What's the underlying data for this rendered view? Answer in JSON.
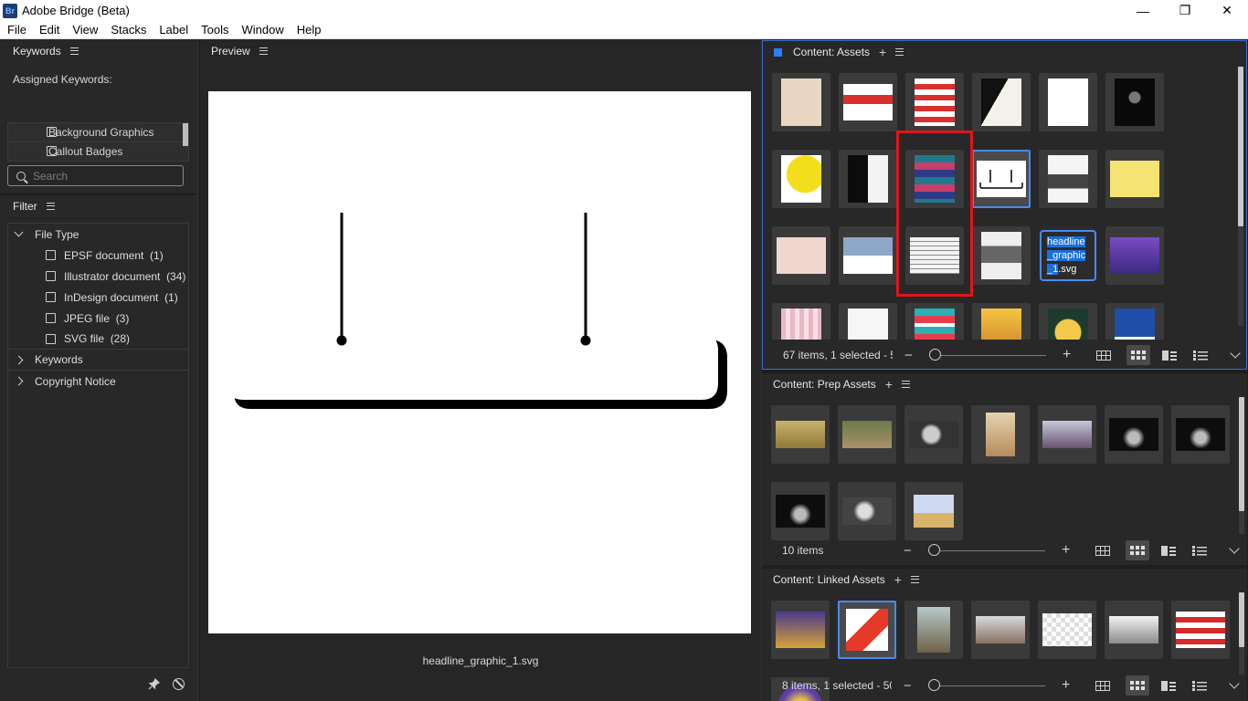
{
  "app": {
    "icon_text": "Br",
    "title": "Adobe Bridge (Beta)",
    "controls": {
      "minimize": "—",
      "restore": "❐",
      "close": "✕"
    }
  },
  "menu": [
    "File",
    "Edit",
    "View",
    "Stacks",
    "Label",
    "Tools",
    "Window",
    "Help"
  ],
  "keywords_panel": {
    "title": "Keywords",
    "assigned_label": "Assigned Keywords:",
    "items": [
      "Background Graphics",
      "Callout Badges"
    ],
    "search_placeholder": "Search"
  },
  "filter_panel": {
    "title": "Filter",
    "file_type_label": "File Type",
    "file_types": [
      {
        "label": "EPSF document",
        "count": "(1)"
      },
      {
        "label": "Illustrator document",
        "count": "(34)"
      },
      {
        "label": "InDesign document",
        "count": "(1)"
      },
      {
        "label": "JPEG file",
        "count": "(3)"
      },
      {
        "label": "SVG file",
        "count": "(28)"
      }
    ],
    "keywords_label": "Keywords",
    "copyright_label": "Copyright Notice"
  },
  "preview": {
    "title": "Preview",
    "filename": "headline_graphic_1.svg"
  },
  "content_assets": {
    "title": "Content: Assets",
    "status": "67 items, 1 selected - 5...",
    "rename_text_selected_a": "headline",
    "rename_text_selected_b": "_graphic",
    "rename_text_selected_c": "_1",
    "rename_text_rest": ".svg"
  },
  "content_prep": {
    "title": "Content: Prep Assets",
    "status": "10 items"
  },
  "content_linked": {
    "title": "Content: Linked Assets",
    "status": "8 items, 1 selected - 50..."
  },
  "colors": {
    "accent_blue": "#2d7ff9",
    "selection_border": "#4a8af4",
    "annotation_red": "#e0151b"
  },
  "icons": [
    "search-icon",
    "pin-icon",
    "no-filter-icon",
    "grid-view-icon",
    "thumbnail-view-icon",
    "details-view-icon",
    "list-view-icon",
    "chevron-down-icon"
  ]
}
